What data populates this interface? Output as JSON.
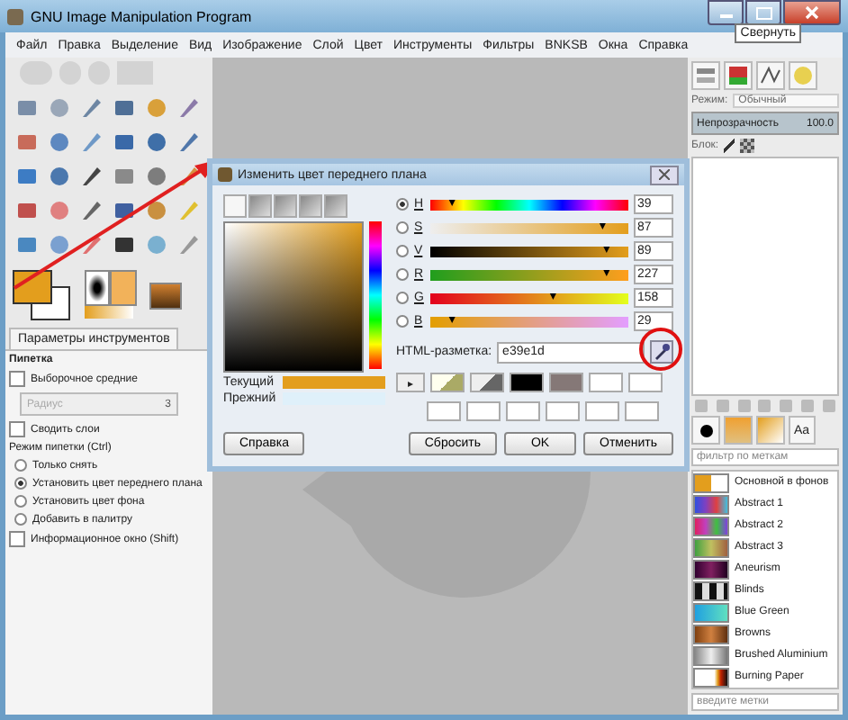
{
  "window": {
    "title": "GNU Image Manipulation Program",
    "tooltip": "Свернуть"
  },
  "menu": [
    "Файл",
    "Правка",
    "Выделение",
    "Вид",
    "Изображение",
    "Слой",
    "Цвет",
    "Инструменты",
    "Фильтры",
    "BNKSB",
    "Окна",
    "Справка"
  ],
  "tool_options": {
    "tab": "Параметры инструментов",
    "title": "Пипетка",
    "sample_average": {
      "label": "Выборочное средние",
      "checked": false
    },
    "radius": {
      "placeholder": "Радиус",
      "value": "3",
      "disabled": true
    },
    "merge": {
      "label": "Сводить слои",
      "checked": false
    },
    "mode_label": "Режим пипетки (Ctrl)",
    "modes": [
      {
        "label": "Только снять",
        "selected": false
      },
      {
        "label": "Установить цвет переднего плана",
        "selected": true
      },
      {
        "label": "Установить цвет фона",
        "selected": false
      },
      {
        "label": "Добавить в палитру",
        "selected": false
      }
    ],
    "info": {
      "label": "Информационное окно (Shift)",
      "checked": false
    }
  },
  "dialog": {
    "title": "Изменить цвет переднего плана",
    "channels": [
      {
        "label": "H",
        "selected": true,
        "level": 0.11,
        "value": "39"
      },
      {
        "label": "S",
        "selected": false,
        "level": 0.87,
        "value": "87"
      },
      {
        "label": "V",
        "selected": false,
        "level": 0.89,
        "value": "89"
      },
      {
        "label": "R",
        "selected": false,
        "level": 0.89,
        "value": "227"
      },
      {
        "label": "G",
        "selected": false,
        "level": 0.62,
        "value": "158"
      },
      {
        "label": "B",
        "selected": false,
        "level": 0.11,
        "value": "29"
      }
    ],
    "html_label": "HTML-разметка:",
    "html_value": "e39e1d",
    "swatch_arrow": "▸",
    "current_label": "Текущий",
    "old_label": "Прежний",
    "buttons": [
      "Справка",
      "Сбросить",
      "OK",
      "Отменить"
    ]
  },
  "layers": {
    "mode_label": "Режим:",
    "mode": "Обычный",
    "opacity_label": "Непрозрачность",
    "opacity": "100.0",
    "level": 1,
    "lock_label": "Блок:"
  },
  "gradients": {
    "tab": "Aa",
    "filter_placeholder": "фильтр по меткам",
    "tags_placeholder": "введите метки",
    "items": [
      "Основной в фонов",
      "Abstract 1",
      "Abstract 2",
      "Abstract 3",
      "Aneurism",
      "Blinds",
      "Blue Green",
      "Browns",
      "Brushed Aluminium",
      "Burning Paper"
    ]
  }
}
